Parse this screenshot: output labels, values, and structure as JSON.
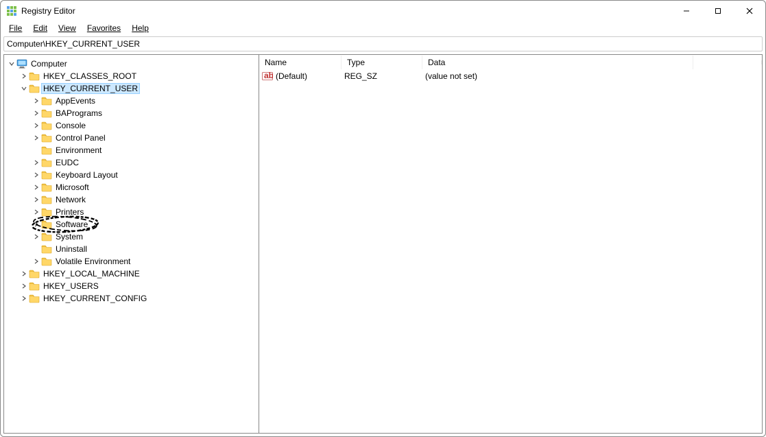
{
  "title": "Registry Editor",
  "menu": [
    "File",
    "Edit",
    "View",
    "Favorites",
    "Help"
  ],
  "address": "Computer\\HKEY_CURRENT_USER",
  "columns": {
    "name": "Name",
    "type": "Type",
    "data": "Data"
  },
  "values": [
    {
      "name": "(Default)",
      "type": "REG_SZ",
      "data": "(value not set)"
    }
  ],
  "tree": {
    "root": "Computer",
    "hives": [
      {
        "label": "HKEY_CLASSES_ROOT",
        "expandable": true
      },
      {
        "label": "HKEY_CURRENT_USER",
        "expandable": true,
        "expanded": true,
        "selected": true,
        "children": [
          {
            "label": "AppEvents",
            "expandable": true
          },
          {
            "label": "BAPrograms",
            "expandable": true
          },
          {
            "label": "Console",
            "expandable": true
          },
          {
            "label": "Control Panel",
            "expandable": true
          },
          {
            "label": "Environment",
            "expandable": false
          },
          {
            "label": "EUDC",
            "expandable": true
          },
          {
            "label": "Keyboard Layout",
            "expandable": true
          },
          {
            "label": "Microsoft",
            "expandable": true
          },
          {
            "label": "Network",
            "expandable": true
          },
          {
            "label": "Printers",
            "expandable": true
          },
          {
            "label": "Software",
            "expandable": true,
            "circled": true
          },
          {
            "label": "System",
            "expandable": true
          },
          {
            "label": "Uninstall",
            "expandable": false
          },
          {
            "label": "Volatile Environment",
            "expandable": true
          }
        ]
      },
      {
        "label": "HKEY_LOCAL_MACHINE",
        "expandable": true
      },
      {
        "label": "HKEY_USERS",
        "expandable": true
      },
      {
        "label": "HKEY_CURRENT_CONFIG",
        "expandable": true
      }
    ]
  }
}
